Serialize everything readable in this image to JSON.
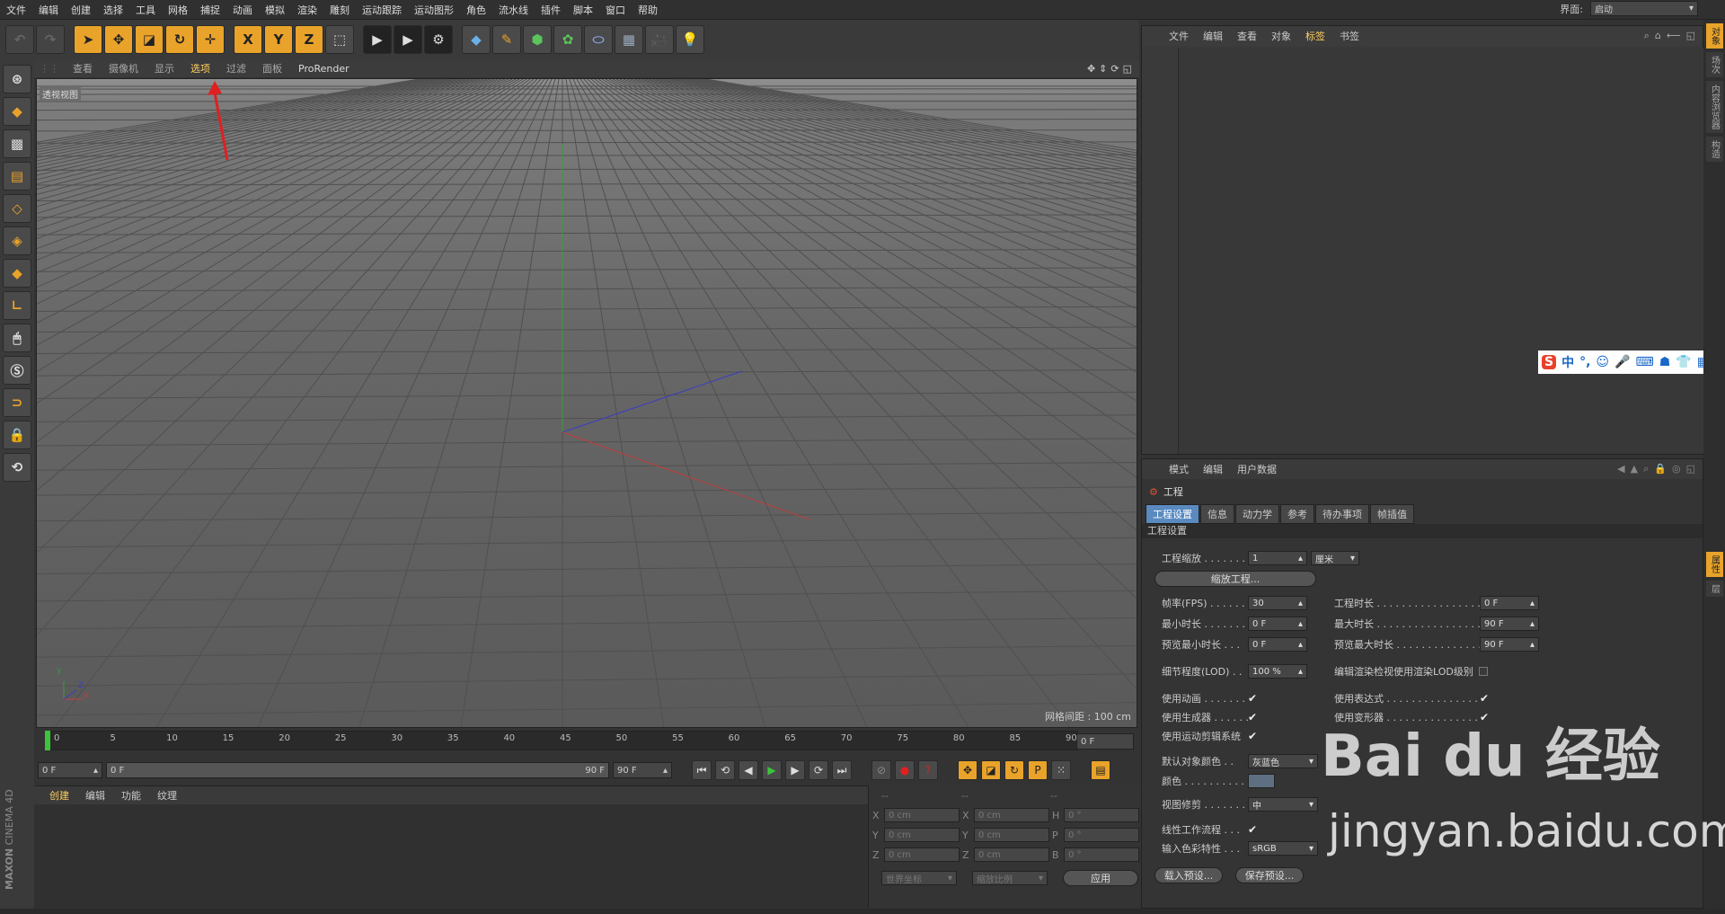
{
  "menu": [
    "文件",
    "编辑",
    "创建",
    "选择",
    "工具",
    "网格",
    "捕捉",
    "动画",
    "模拟",
    "渲染",
    "雕刻",
    "运动跟踪",
    "运动图形",
    "角色",
    "流水线",
    "插件",
    "脚本",
    "窗口",
    "帮助"
  ],
  "layout": {
    "label": "界面:",
    "value": "启动"
  },
  "viewport": {
    "menu": [
      "查看",
      "摄像机",
      "显示",
      "选项",
      "过滤",
      "面板",
      "ProRender"
    ],
    "label": "透视视图",
    "grid_spacing": "网格间距 : 100 cm",
    "axis_x": "X",
    "axis_y": "Y",
    "axis_z": "Z"
  },
  "timeline": {
    "ticks": [
      "0",
      "5",
      "10",
      "15",
      "20",
      "25",
      "30",
      "35",
      "40",
      "45",
      "50",
      "55",
      "60",
      "65",
      "70",
      "75",
      "80",
      "85",
      "90"
    ],
    "current_frame": "0 F",
    "start": "0 F",
    "range_start": "0 F",
    "range_end": "90 F",
    "end": "90 F"
  },
  "material": {
    "menu": [
      "创建",
      "编辑",
      "功能",
      "纹理"
    ]
  },
  "coords": {
    "headers": [
      "--",
      "--",
      "--"
    ],
    "rows": [
      {
        "a": "X",
        "av": "0 cm",
        "b": "X",
        "bv": "0 cm",
        "c": "H",
        "cv": "0 °"
      },
      {
        "a": "Y",
        "av": "0 cm",
        "b": "Y",
        "bv": "0 cm",
        "c": "P",
        "cv": "0 °"
      },
      {
        "a": "Z",
        "av": "0 cm",
        "b": "Z",
        "bv": "0 cm",
        "c": "B",
        "cv": "0 °"
      }
    ],
    "world": "世界坐标",
    "scale": "缩放比例",
    "apply": "应用"
  },
  "object_manager": {
    "menu": [
      "文件",
      "编辑",
      "查看",
      "对象",
      "标签",
      "书签"
    ]
  },
  "ime": {
    "label": "中",
    "punct": "°,"
  },
  "attributes": {
    "menu": [
      "模式",
      "编辑",
      "用户数据"
    ],
    "title": "工程",
    "tabs": [
      "工程设置",
      "信息",
      "动力学",
      "参考",
      "待办事项",
      "帧插值"
    ],
    "section": "工程设置",
    "scale_label": "工程缩放 . . . . . . .",
    "scale_value": "1",
    "scale_unit": "厘米",
    "scale_button": "缩放工程...",
    "fps_label": "帧率(FPS) . . . . . .",
    "fps_value": "30",
    "duration_label": "工程时长 . . . . . . . . . . . . . . . . .",
    "duration_value": "0 F",
    "min_label": "最小时长 . . . . . . .",
    "min_value": "0 F",
    "max_label": "最大时长 . . . . . . . . . . . . . . . . .",
    "max_value": "90 F",
    "pmin_label": "预览最小时长 . . .",
    "pmin_value": "0 F",
    "pmax_label": "预览最大时长 . . . . . . . . . . . . . .",
    "pmax_value": "90 F",
    "lod_label": "细节程度(LOD) . .",
    "lod_value": "100 %",
    "lod_render_label": "编辑渲染检视使用渲染LOD级别",
    "anim_label": "使用动画 . . . . . . .",
    "expr_label": "使用表达式 . . . . . . . . . . . . . . . .",
    "gen_label": "使用生成器 . . . . . .",
    "deform_label": "使用变形器 . . . . . . . . . . . . . . . .",
    "motion_label": "使用运动剪辑系统",
    "default_color_label": "默认对象颜色 . .",
    "default_color_value": "灰蓝色",
    "color_label": "颜色 . . . . . . . . . .",
    "clip_label": "视图修剪 . . . . . . .",
    "clip_value": "中",
    "linear_label": "线性工作流程 . . .",
    "input_label": "输入色彩特性 . . .",
    "input_value": "sRGB",
    "load_preset": "载入预设...",
    "save_preset": "保存预设..."
  },
  "right_tabs": [
    "对象",
    "场次",
    "内容浏览器",
    "构造",
    "属性",
    "层"
  ],
  "watermark": {
    "brand": "Bai du 经验",
    "url": "jingyan.baidu.com"
  },
  "maxon": {
    "line1": "MAXON",
    "line2": "CINEMA 4D"
  },
  "colors": {
    "accent": "#e9a32a",
    "active_menu": "#ffd060",
    "tab_active": "#5a8ac0",
    "axis_x": "#c43c3c",
    "axis_y": "#3c9c3c",
    "axis_z": "#3c3cc4"
  }
}
